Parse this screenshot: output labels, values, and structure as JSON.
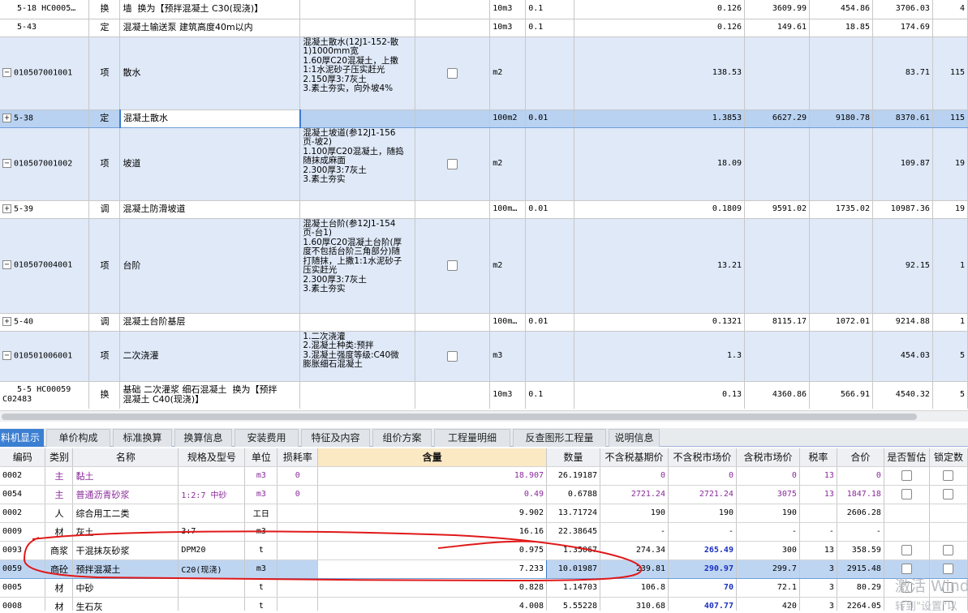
{
  "top_rows": [
    {
      "style": "w",
      "h": 23,
      "expander": "",
      "code": "5-18 HC0005…",
      "type": "换",
      "name": "墙  换为【预拌混凝土 C30(现浇)】",
      "features": [],
      "checkbox": false,
      "unit": "10m3",
      "coef": "0.1",
      "qty": "0.126",
      "c1": "3609.99",
      "c2": "454.86",
      "c3": "3706.03",
      "c4": "4"
    },
    {
      "style": "w",
      "h": 22,
      "expander": "",
      "code": "5-43",
      "type": "定",
      "name": "混凝土输送泵 建筑高度40m以内",
      "features": [],
      "checkbox": false,
      "unit": "10m3",
      "coef": "0.1",
      "qty": "0.126",
      "c1": "149.61",
      "c2": "18.85",
      "c3": "174.69",
      "c4": ""
    },
    {
      "style": "b",
      "h": 90,
      "expander": "−",
      "code": "010507001001",
      "type": "项",
      "name": "散水",
      "features": [
        "混凝土散水(12J1-152-散",
        "1)1000mm宽",
        "1.60厚C20混凝土，上撒",
        "1:1水泥砂子压实赶光",
        "2.150厚3:7灰土",
        "3.素土夯实，向外坡4%"
      ],
      "checkbox": true,
      "unit": "m2",
      "coef": "",
      "qty": "138.53",
      "c1": "",
      "c2": "",
      "c3": "83.71",
      "c4": "115"
    },
    {
      "style": "sel",
      "h": 22,
      "expander": "+",
      "code": "5-38",
      "type": "定",
      "name": "混凝土散水",
      "features": [],
      "checkbox": false,
      "unit": "100m2",
      "coef": "0.01",
      "qty": "1.3853",
      "c1": "6627.29",
      "c2": "9180.78",
      "c3": "8370.61",
      "c4": "115"
    },
    {
      "style": "b",
      "h": 90,
      "expander": "−",
      "code": "010507001002",
      "type": "项",
      "name": "坡道",
      "features": [
        "混凝土坡道(参12J1-156",
        "页-坡2)",
        "1.100厚C20混凝土，随捣",
        "随抹成麻面",
        "2.300厚3:7灰土",
        "3.素土夯实"
      ],
      "checkbox": true,
      "unit": "m2",
      "coef": "",
      "qty": "18.09",
      "c1": "",
      "c2": "",
      "c3": "109.87",
      "c4": "19"
    },
    {
      "style": "w",
      "h": 22,
      "expander": "+",
      "code": "5-39",
      "type": "调",
      "name": "混凝土防滑坡道",
      "features": [],
      "checkbox": false,
      "unit": "100m…",
      "coef": "0.01",
      "qty": "0.1809",
      "c1": "9591.02",
      "c2": "1735.02",
      "c3": "10987.36",
      "c4": "19"
    },
    {
      "style": "b",
      "h": 117,
      "expander": "−",
      "code": "010507004001",
      "type": "项",
      "name": "台阶",
      "features": [
        "混凝土台阶(参12J1-154",
        "页-台1)",
        "1.60厚C20混凝土台阶(厚",
        "度不包括台阶三角部分)随",
        "打随抹，上撒1:1水泥砂子",
        "压实赶光",
        "2.300厚3:7灰土",
        "3.素土夯实"
      ],
      "checkbox": true,
      "unit": "m2",
      "coef": "",
      "qty": "13.21",
      "c1": "",
      "c2": "",
      "c3": "92.15",
      "c4": "1"
    },
    {
      "style": "w",
      "h": 22,
      "expander": "+",
      "code": "5-40",
      "type": "调",
      "name": "混凝土台阶基层",
      "features": [],
      "checkbox": false,
      "unit": "100m…",
      "coef": "0.01",
      "qty": "0.1321",
      "c1": "8115.17",
      "c2": "1072.01",
      "c3": "9214.88",
      "c4": "1"
    },
    {
      "style": "b",
      "h": 62,
      "expander": "−",
      "code": "010501006001",
      "type": "项",
      "name": "二次浇灌",
      "features": [
        "1.二次浇灌",
        "2.混凝土种类:预拌",
        "3.混凝土强度等级:C40微",
        "膨胀细石混凝土"
      ],
      "checkbox": true,
      "unit": "m3",
      "coef": "",
      "qty": "1.3",
      "c1": "",
      "c2": "",
      "c3": "454.03",
      "c4": "5"
    },
    {
      "style": "w",
      "h": 34,
      "expander": "",
      "code": "5-5 HC00059\nC02483",
      "type": "换",
      "name": "基础 二次灌浆 细石混凝土  换为【预拌\n混凝土 C40(现浇)】",
      "features": [],
      "checkbox": false,
      "unit": "10m3",
      "coef": "0.1",
      "qty": "0.13",
      "c1": "4360.86",
      "c2": "566.91",
      "c3": "4540.32",
      "c4": "5"
    }
  ],
  "tabs": [
    {
      "label": "料机显示",
      "active": true
    },
    {
      "label": "单价构成",
      "active": false
    },
    {
      "label": "标准换算",
      "active": false
    },
    {
      "label": "换算信息",
      "active": false
    },
    {
      "label": "安装费用",
      "active": false
    },
    {
      "label": "特征及内容",
      "active": false
    },
    {
      "label": "组价方案",
      "active": false
    },
    {
      "label": "工程量明细",
      "active": false
    },
    {
      "label": "反查图形工程量",
      "active": false
    },
    {
      "label": "说明信息",
      "active": false
    }
  ],
  "bottom_headers": [
    "编码",
    "类别",
    "名称",
    "规格及型号",
    "单位",
    "损耗率",
    "含量",
    "数量",
    "不含税基期价",
    "不含税市场价",
    "含税市场价",
    "税率",
    "合价",
    "是否暂估",
    "锁定数"
  ],
  "bottom_rows": [
    {
      "code": "0002",
      "cat": "主",
      "name": "黏土",
      "spec": "",
      "unit": "m3",
      "loss": "0",
      "content": "18.907",
      "qty": "26.19187",
      "base": "0",
      "market": "0",
      "taxmarket": "0",
      "rate": "13",
      "total": "0",
      "est": true,
      "color": "pur",
      "sel": false,
      "mkbold": false
    },
    {
      "code": "0054",
      "cat": "主",
      "name": "普通沥青砂浆",
      "spec": "1:2:7 中砂",
      "unit": "m3",
      "loss": "0",
      "content": "0.49",
      "qty": "0.6788",
      "base": "2721.24",
      "market": "2721.24",
      "taxmarket": "3075",
      "rate": "13",
      "total": "1847.18",
      "est": true,
      "color": "pur",
      "sel": false,
      "mkbold": false
    },
    {
      "code": "0002",
      "cat": "人",
      "name": "综合用工二类",
      "spec": "",
      "unit": "工日",
      "loss": "",
      "content": "9.902",
      "qty": "13.71724",
      "base": "190",
      "market": "190",
      "taxmarket": "190",
      "rate": "",
      "total": "2606.28",
      "est": false,
      "color": "",
      "sel": false,
      "mkbold": false
    },
    {
      "code": "0009",
      "cat": "材",
      "name": "灰土",
      "spec": "3:7",
      "unit": "m3",
      "loss": "",
      "content": "16.16",
      "qty": "22.38645",
      "base": "-",
      "market": "-",
      "taxmarket": "-",
      "rate": "-",
      "total": "-",
      "est": false,
      "color": "",
      "sel": false,
      "mkbold": false
    },
    {
      "code": "0093",
      "cat": "商浆",
      "name": "干混抹灰砂浆",
      "spec": "DPM20",
      "unit": "t",
      "loss": "",
      "content": "0.975",
      "qty": "1.35067",
      "base": "274.34",
      "market": "265.49",
      "taxmarket": "300",
      "rate": "13",
      "total": "358.59",
      "est": true,
      "color": "",
      "sel": false,
      "mkbold": true
    },
    {
      "code": "0059",
      "cat": "商砼",
      "name": "预拌混凝土",
      "spec": "C20(现浇)",
      "unit": "m3",
      "loss": "",
      "content": "7.233",
      "qty": "10.01987",
      "base": "239.81",
      "market": "290.97",
      "taxmarket": "299.7",
      "rate": "3",
      "total": "2915.48",
      "est": true,
      "color": "",
      "sel": true,
      "mkbold": true
    },
    {
      "code": "0005",
      "cat": "材",
      "name": "中砂",
      "spec": "",
      "unit": "t",
      "loss": "",
      "content": "0.828",
      "qty": "1.14703",
      "base": "106.8",
      "market": "70",
      "taxmarket": "72.1",
      "rate": "3",
      "total": "80.29",
      "est": true,
      "color": "",
      "sel": false,
      "mkbold": true
    },
    {
      "code": "0008",
      "cat": "材",
      "name": "生石灰",
      "spec": "",
      "unit": "t",
      "loss": "",
      "content": "4.008",
      "qty": "5.55228",
      "base": "310.68",
      "market": "407.77",
      "taxmarket": "420",
      "rate": "3",
      "total": "2264.05",
      "est": true,
      "color": "",
      "sel": false,
      "mkbold": true
    }
  ],
  "watermark": {
    "line1": "激活 Wind",
    "line2": "转到\"设置\"以"
  }
}
